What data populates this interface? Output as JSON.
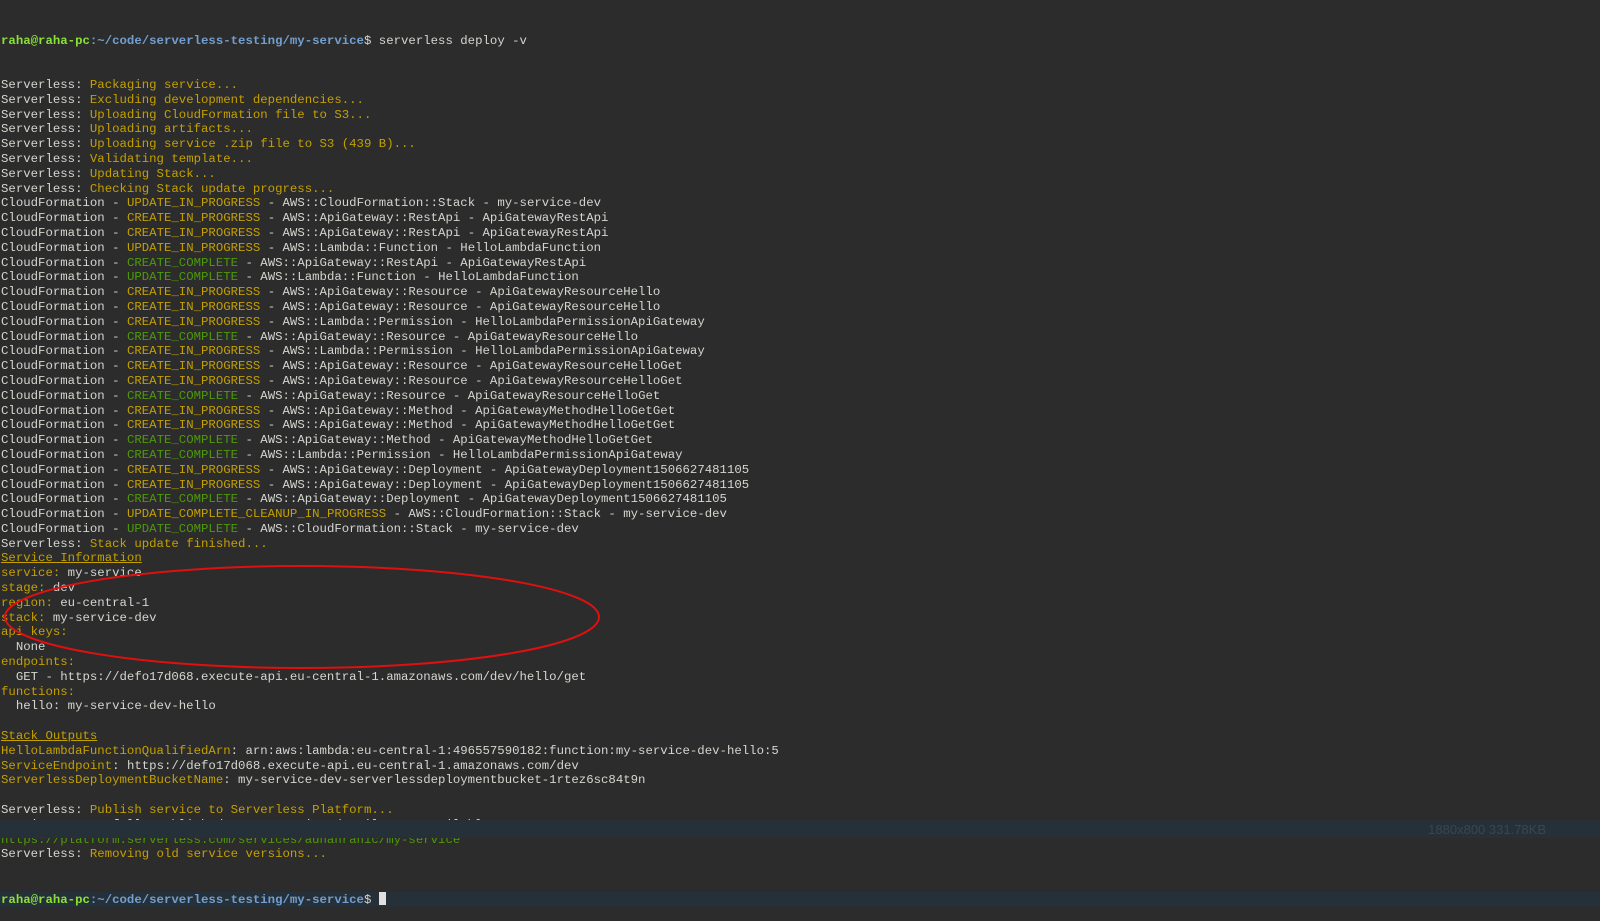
{
  "colors": {
    "background": "#2c2c2c",
    "text": "#d3d7cf",
    "yellow": "#c4a000",
    "green": "#4e9a06",
    "prompt_user": "#8ae234",
    "prompt_path": "#729fcf",
    "annotation": "#e01010"
  },
  "prompt": {
    "user_host": "raha@raha-pc",
    "path": ":~/code/serverless-testing/my-service",
    "symbol": "$ ",
    "command": "serverless deploy -v"
  },
  "lines": [
    [
      [
        "w",
        "Serverless: "
      ],
      [
        "y",
        "Packaging service..."
      ]
    ],
    [
      [
        "w",
        "Serverless: "
      ],
      [
        "y",
        "Excluding development dependencies..."
      ]
    ],
    [
      [
        "w",
        "Serverless: "
      ],
      [
        "y",
        "Uploading CloudFormation file to S3..."
      ]
    ],
    [
      [
        "w",
        "Serverless: "
      ],
      [
        "y",
        "Uploading artifacts..."
      ]
    ],
    [
      [
        "w",
        "Serverless: "
      ],
      [
        "y",
        "Uploading service .zip file to S3 (439 B)..."
      ]
    ],
    [
      [
        "w",
        "Serverless: "
      ],
      [
        "y",
        "Validating template..."
      ]
    ],
    [
      [
        "w",
        "Serverless: "
      ],
      [
        "y",
        "Updating Stack..."
      ]
    ],
    [
      [
        "w",
        "Serverless: "
      ],
      [
        "y",
        "Checking Stack update progress..."
      ]
    ],
    [
      [
        "w",
        "CloudFormation - "
      ],
      [
        "y",
        "UPDATE_IN_PROGRESS"
      ],
      [
        "w",
        " - AWS::CloudFormation::Stack - my-service-dev"
      ]
    ],
    [
      [
        "w",
        "CloudFormation - "
      ],
      [
        "y",
        "CREATE_IN_PROGRESS"
      ],
      [
        "w",
        " - AWS::ApiGateway::RestApi - ApiGatewayRestApi"
      ]
    ],
    [
      [
        "w",
        "CloudFormation - "
      ],
      [
        "y",
        "CREATE_IN_PROGRESS"
      ],
      [
        "w",
        " - AWS::ApiGateway::RestApi - ApiGatewayRestApi"
      ]
    ],
    [
      [
        "w",
        "CloudFormation - "
      ],
      [
        "y",
        "UPDATE_IN_PROGRESS"
      ],
      [
        "w",
        " - AWS::Lambda::Function - HelloLambdaFunction"
      ]
    ],
    [
      [
        "w",
        "CloudFormation - "
      ],
      [
        "g",
        "CREATE_COMPLETE"
      ],
      [
        "w",
        " - AWS::ApiGateway::RestApi - ApiGatewayRestApi"
      ]
    ],
    [
      [
        "w",
        "CloudFormation - "
      ],
      [
        "g",
        "UPDATE_COMPLETE"
      ],
      [
        "w",
        " - AWS::Lambda::Function - HelloLambdaFunction"
      ]
    ],
    [
      [
        "w",
        "CloudFormation - "
      ],
      [
        "y",
        "CREATE_IN_PROGRESS"
      ],
      [
        "w",
        " - AWS::ApiGateway::Resource - ApiGatewayResourceHello"
      ]
    ],
    [
      [
        "w",
        "CloudFormation - "
      ],
      [
        "y",
        "CREATE_IN_PROGRESS"
      ],
      [
        "w",
        " - AWS::ApiGateway::Resource - ApiGatewayResourceHello"
      ]
    ],
    [
      [
        "w",
        "CloudFormation - "
      ],
      [
        "y",
        "CREATE_IN_PROGRESS"
      ],
      [
        "w",
        " - AWS::Lambda::Permission - HelloLambdaPermissionApiGateway"
      ]
    ],
    [
      [
        "w",
        "CloudFormation - "
      ],
      [
        "g",
        "CREATE_COMPLETE"
      ],
      [
        "w",
        " - AWS::ApiGateway::Resource - ApiGatewayResourceHello"
      ]
    ],
    [
      [
        "w",
        "CloudFormation - "
      ],
      [
        "y",
        "CREATE_IN_PROGRESS"
      ],
      [
        "w",
        " - AWS::Lambda::Permission - HelloLambdaPermissionApiGateway"
      ]
    ],
    [
      [
        "w",
        "CloudFormation - "
      ],
      [
        "y",
        "CREATE_IN_PROGRESS"
      ],
      [
        "w",
        " - AWS::ApiGateway::Resource - ApiGatewayResourceHelloGet"
      ]
    ],
    [
      [
        "w",
        "CloudFormation - "
      ],
      [
        "y",
        "CREATE_IN_PROGRESS"
      ],
      [
        "w",
        " - AWS::ApiGateway::Resource - ApiGatewayResourceHelloGet"
      ]
    ],
    [
      [
        "w",
        "CloudFormation - "
      ],
      [
        "g",
        "CREATE_COMPLETE"
      ],
      [
        "w",
        " - AWS::ApiGateway::Resource - ApiGatewayResourceHelloGet"
      ]
    ],
    [
      [
        "w",
        "CloudFormation - "
      ],
      [
        "y",
        "CREATE_IN_PROGRESS"
      ],
      [
        "w",
        " - AWS::ApiGateway::Method - ApiGatewayMethodHelloGetGet"
      ]
    ],
    [
      [
        "w",
        "CloudFormation - "
      ],
      [
        "y",
        "CREATE_IN_PROGRESS"
      ],
      [
        "w",
        " - AWS::ApiGateway::Method - ApiGatewayMethodHelloGetGet"
      ]
    ],
    [
      [
        "w",
        "CloudFormation - "
      ],
      [
        "g",
        "CREATE_COMPLETE"
      ],
      [
        "w",
        " - AWS::ApiGateway::Method - ApiGatewayMethodHelloGetGet"
      ]
    ],
    [
      [
        "w",
        "CloudFormation - "
      ],
      [
        "g",
        "CREATE_COMPLETE"
      ],
      [
        "w",
        " - AWS::Lambda::Permission - HelloLambdaPermissionApiGateway"
      ]
    ],
    [
      [
        "w",
        "CloudFormation - "
      ],
      [
        "y",
        "CREATE_IN_PROGRESS"
      ],
      [
        "w",
        " - AWS::ApiGateway::Deployment - ApiGatewayDeployment1506627481105"
      ]
    ],
    [
      [
        "w",
        "CloudFormation - "
      ],
      [
        "y",
        "CREATE_IN_PROGRESS"
      ],
      [
        "w",
        " - AWS::ApiGateway::Deployment - ApiGatewayDeployment1506627481105"
      ]
    ],
    [
      [
        "w",
        "CloudFormation - "
      ],
      [
        "g",
        "CREATE_COMPLETE"
      ],
      [
        "w",
        " - AWS::ApiGateway::Deployment - ApiGatewayDeployment1506627481105"
      ]
    ],
    [
      [
        "w",
        "CloudFormation - "
      ],
      [
        "y",
        "UPDATE_COMPLETE_CLEANUP_IN_PROGRESS"
      ],
      [
        "w",
        " - AWS::CloudFormation::Stack - my-service-dev"
      ]
    ],
    [
      [
        "w",
        "CloudFormation - "
      ],
      [
        "g",
        "UPDATE_COMPLETE"
      ],
      [
        "w",
        " - AWS::CloudFormation::Stack - my-service-dev"
      ]
    ],
    [
      [
        "w",
        "Serverless: "
      ],
      [
        "y",
        "Stack update finished..."
      ]
    ],
    [
      [
        "yu",
        "Service Information"
      ]
    ],
    [
      [
        "y",
        "service: "
      ],
      [
        "w",
        "my-service"
      ]
    ],
    [
      [
        "y",
        "stage: "
      ],
      [
        "w",
        "dev"
      ]
    ],
    [
      [
        "y",
        "region: "
      ],
      [
        "w",
        "eu-central-1"
      ]
    ],
    [
      [
        "y",
        "stack: "
      ],
      [
        "w",
        "my-service-dev"
      ]
    ],
    [
      [
        "y",
        "api keys:"
      ]
    ],
    [
      [
        "w",
        "  None"
      ]
    ],
    [
      [
        "y",
        "endpoints:"
      ]
    ],
    [
      [
        "w",
        "  GET - https://defo17d068.execute-api.eu-central-1.amazonaws.com/dev/hello/get"
      ]
    ],
    [
      [
        "y",
        "functions:"
      ]
    ],
    [
      [
        "w",
        "  hello: my-service-dev-hello"
      ]
    ],
    [],
    [
      [
        "yu",
        "Stack Outputs"
      ]
    ],
    [
      [
        "y",
        "HelloLambdaFunctionQualifiedArn"
      ],
      [
        "w",
        ": arn:aws:lambda:eu-central-1:496557590182:function:my-service-dev-hello:5"
      ]
    ],
    [
      [
        "y",
        "ServiceEndpoint"
      ],
      [
        "w",
        ": https://defo17d068.execute-api.eu-central-1.amazonaws.com/dev"
      ]
    ],
    [
      [
        "y",
        "ServerlessDeploymentBucketName"
      ],
      [
        "w",
        ": my-service-dev-serverlessdeploymentbucket-1rtez6sc84t9n"
      ]
    ],
    [],
    [
      [
        "w",
        "Serverless: "
      ],
      [
        "y",
        "Publish service to Serverless Platform..."
      ]
    ],
    [
      [
        "w",
        "Service successfully published! Your service details are available at:"
      ]
    ],
    [
      [
        "g",
        "https://platform.serverless.com/services/adnanrahic/my-service"
      ]
    ],
    [
      [
        "w",
        "Serverless: "
      ],
      [
        "y",
        "Removing old service versions..."
      ]
    ]
  ],
  "statusbar": {
    "info": "1880x800 331.78KB"
  }
}
